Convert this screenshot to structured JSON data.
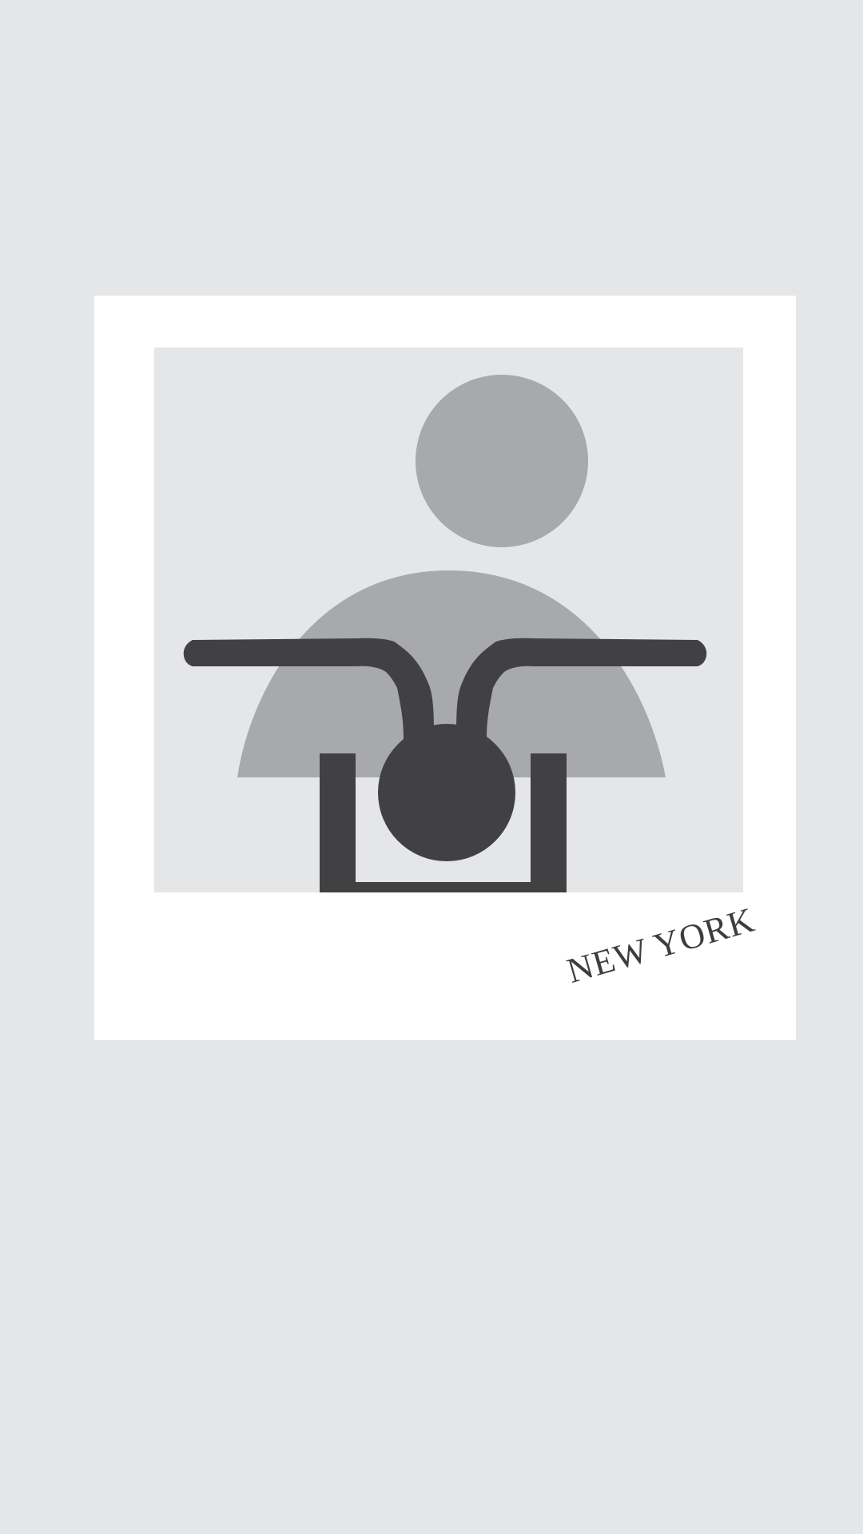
{
  "caption": {
    "text": "NEW YORK"
  },
  "placeholder": {
    "icon": "person-placeholder-icon",
    "overlay_icon": "bicycle-handlebar-icon"
  },
  "colors": {
    "background": "#e5e6e8",
    "frame": "#ffffff",
    "placeholder_figure": "#a8a9ab",
    "overlay": "#414143",
    "caption": "#3d3d3f"
  }
}
